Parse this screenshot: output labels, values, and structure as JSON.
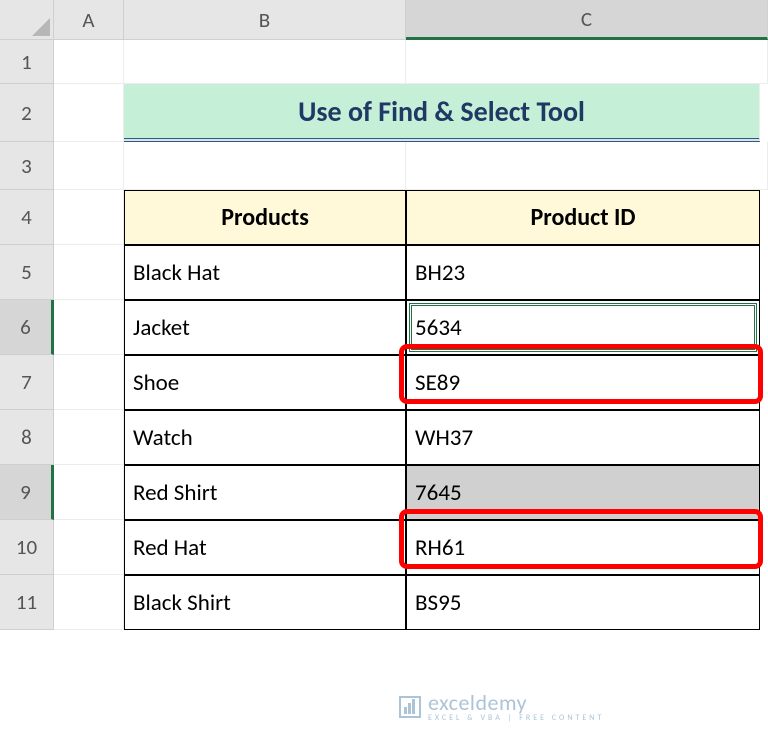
{
  "columns": [
    "A",
    "B",
    "C"
  ],
  "rows": [
    "1",
    "2",
    "3",
    "4",
    "5",
    "6",
    "7",
    "8",
    "9",
    "10",
    "11"
  ],
  "title": "Use of Find & Select Tool",
  "table": {
    "headers": [
      "Products",
      "Product ID"
    ],
    "data": [
      {
        "product": "Black Hat",
        "id": "BH23"
      },
      {
        "product": "Jacket",
        "id": "5634"
      },
      {
        "product": "Shoe",
        "id": "SE89"
      },
      {
        "product": "Watch",
        "id": "WH37"
      },
      {
        "product": "Red Shirt",
        "id": "7645"
      },
      {
        "product": "Red Hat",
        "id": "RH61"
      },
      {
        "product": "Black Shirt",
        "id": "BS95"
      }
    ]
  },
  "active_column": "C",
  "active_rows": [
    "6",
    "9"
  ],
  "active_cell": "C6",
  "selected_range_cell": "C9",
  "highlighted_cells": [
    "C6",
    "C9"
  ],
  "watermark": {
    "brand": "exceldemy",
    "tagline": "EXCEL & VBA | FREE CONTENT"
  }
}
